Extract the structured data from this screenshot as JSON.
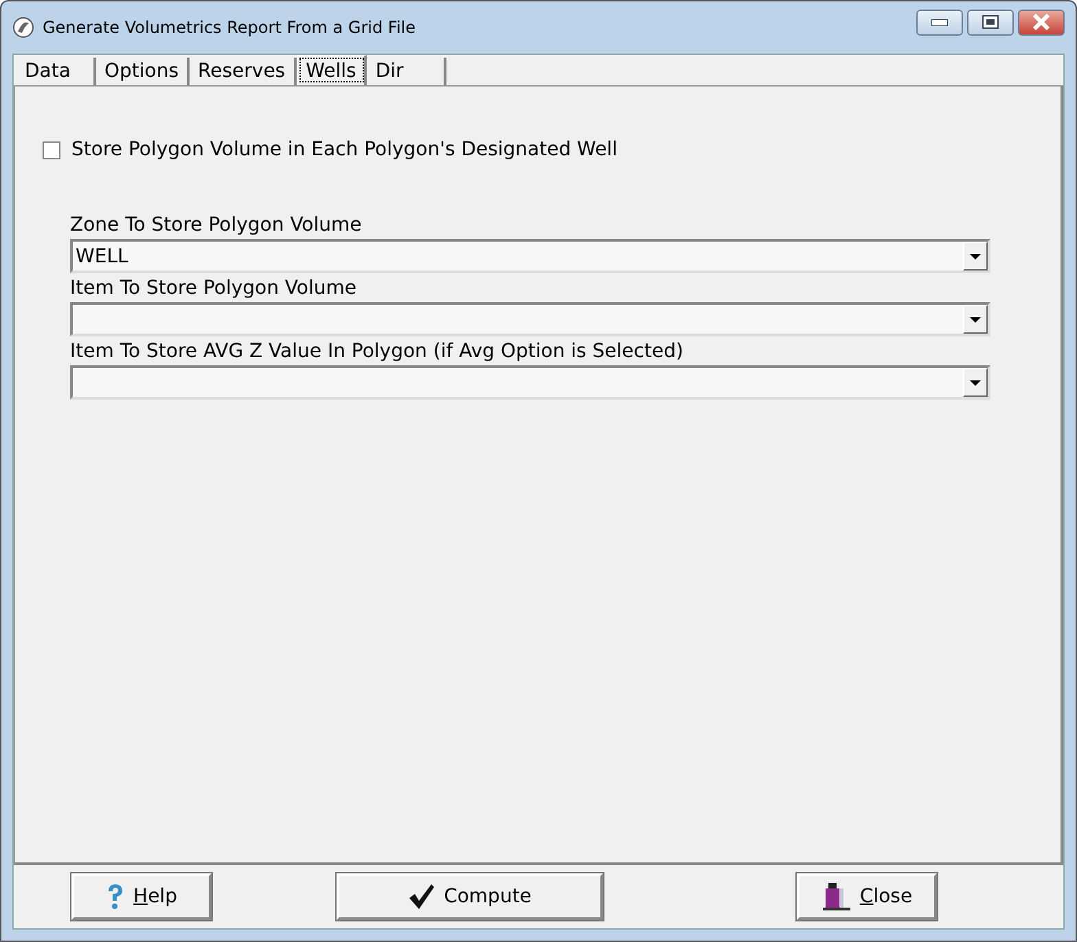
{
  "window": {
    "title": "Generate Volumetrics Report From a Grid File"
  },
  "tabs": [
    {
      "label": "Data",
      "selected": false
    },
    {
      "label": "Options",
      "selected": false
    },
    {
      "label": "Reserves",
      "selected": false
    },
    {
      "label": "Wells",
      "selected": true
    },
    {
      "label": "Dir",
      "selected": false
    }
  ],
  "store_checkbox": {
    "label": "Store Polygon Volume in Each Polygon's Designated Well",
    "checked": false
  },
  "fields": [
    {
      "label": "Zone To Store Polygon Volume",
      "value": "WELL"
    },
    {
      "label": "Item To Store Polygon Volume"
    },
    {
      "label": "Item To Store AVG Z Value In Polygon (if Avg Option is Selected)"
    }
  ],
  "buttons": [
    {
      "kind": "help",
      "label": "Help"
    },
    {
      "kind": "compute",
      "label": "Compute"
    },
    {
      "kind": "close",
      "label": "Close"
    }
  ]
}
